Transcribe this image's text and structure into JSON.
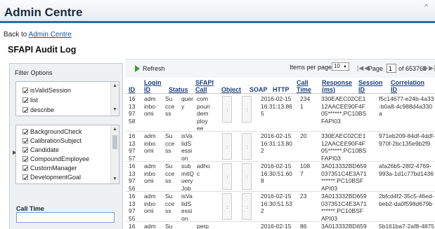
{
  "header": {
    "title": "Admin Centre"
  },
  "nav": {
    "back_prefix": "Back to ",
    "back_link": "Admin Centre"
  },
  "page": {
    "title": "SFAPI Audit Log"
  },
  "filter": {
    "title": "Filter Options",
    "group1": [
      "isValidSession",
      "list",
      "describe"
    ],
    "group2": [
      "BackgroundCheck",
      "CalibrationSubject",
      "Candidate",
      "CompoundEmployee",
      "CustomManager",
      "DevelopmentGoal"
    ],
    "call_time_label": "Call Time",
    "call_time_value": ""
  },
  "toolbar": {
    "refresh": "Refresh",
    "items_label": "Items per page",
    "items_value": "10",
    "page_label": "Page",
    "page_value": "1",
    "page_total": "of 653768"
  },
  "table": {
    "headers": {
      "id": "ID",
      "login_id": "Login\nID",
      "status": "Status",
      "sfapi_call": "SFAPI\nCall",
      "object": "Object",
      "soap": "SOAP",
      "http": "HTTP",
      "call_time": "Call\nTime",
      "response": "Response\n(ms)",
      "session_id": "Session\nID",
      "correlation_id": "Correlation\nID"
    },
    "rows": [
      {
        "id": "16\n13\n97\n58",
        "login": "adm\ninbo\nomi",
        "status": "Su\ncce\nss",
        "call": "quer\ny",
        "object": "com\npoun\ndem\nploy\nee",
        "http": "2016-02-15\n16:31:13.86\n5",
        "ctime": "234\n1",
        "resp": "330EAEC02CE1\n12AACEE90F4F\n05******.PC10BS\nFAPI03",
        "session": "",
        "corr": "f5c14677-e24b-4a33\n-b0a8-4c988d4a330\na"
      },
      {
        "id": "16\n13\n97\n57",
        "login": "adm\ninbo\nomi",
        "status": "Su\ncce\nss",
        "call": "isVa\nlidS\nessi\non",
        "object": "",
        "http": "2016-02-15\n16:31:13.80\n2",
        "ctime": "20",
        "resp": "330EAEC02CE1\n12AACEE90F4F\n05******.PC10BS\nFAPI03",
        "session": "",
        "corr": "971eb209-84df-4ddf-\n970f-2bc135e9b2f9"
      },
      {
        "id": "16\n13\n97\n56",
        "login": "adm\ninbo\nomi",
        "status": "Su\ncce\nss",
        "call": "sub\nmitQ\nuery\nJob",
        "object": "adho\nc",
        "http": "2016-02-15\n16:30:51.60\n8",
        "ctime": "108\n7",
        "resp": "3A013332BD659\n037351C4E3A71\n******.PC10BSF\nAPI03",
        "session": "",
        "corr": "afa26b5-28f2-4769-\n993a-1d1c77bd1436"
      },
      {
        "id": "16\n13\n97\n55",
        "login": "adm\ninbo\nomi",
        "status": "Su\ncce\nss",
        "call": "isVa\nlidS\nessi\non",
        "object": "",
        "http": "2016-02-15\n16:30:51.53\n2",
        "ctime": "23",
        "resp": "3A013332BD659\n037351C4E3A71\n******.PC10BSF\nAPI03",
        "session": "",
        "corr": "2bfcd4f2-35c5-46ed-\nbeb2-da0f598d679b"
      },
      {
        "id": "16",
        "login": "adm",
        "status": "Su",
        "call": "",
        "object": "perp",
        "http": "2016-02-15",
        "ctime": "86",
        "resp": "3A013332BD659",
        "session": "",
        "corr": "5b161ba7-2af8-4875"
      }
    ]
  },
  "colors": {
    "accent": "#2a6ea8",
    "link": "#1a4f99",
    "refresh": "#3a9a3a"
  }
}
